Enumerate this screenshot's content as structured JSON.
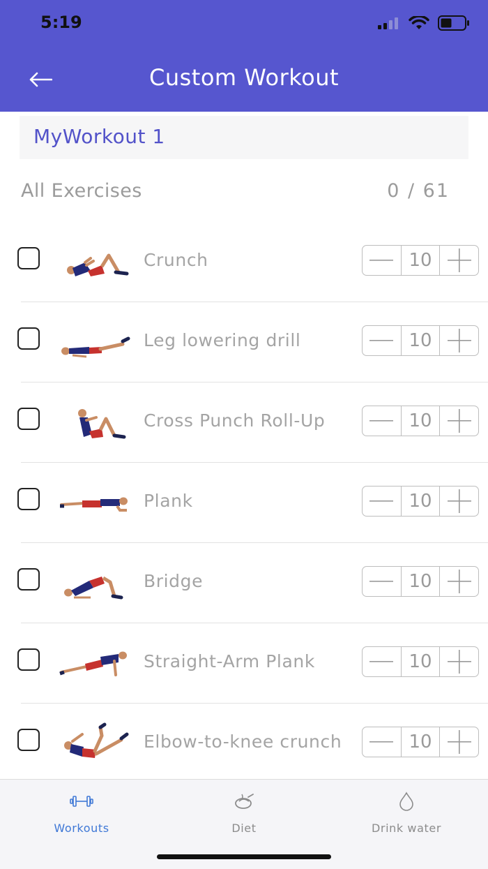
{
  "status_bar": {
    "time": "5:19"
  },
  "header": {
    "title": "Custom Workout",
    "back_icon": "back-arrow-icon"
  },
  "workout": {
    "name": "MyWorkout 1"
  },
  "list_header": {
    "label": "All Exercises",
    "count": "0 / 61"
  },
  "exercises": [
    {
      "name": "Crunch",
      "reps": "10",
      "checked": false
    },
    {
      "name": "Leg lowering drill",
      "reps": "10",
      "checked": false
    },
    {
      "name": "Cross Punch Roll-Up",
      "reps": "10",
      "checked": false
    },
    {
      "name": "Plank",
      "reps": "10",
      "checked": false
    },
    {
      "name": "Bridge",
      "reps": "10",
      "checked": false
    },
    {
      "name": "Straight-Arm Plank",
      "reps": "10",
      "checked": false
    },
    {
      "name": "Elbow-to-knee crunch",
      "reps": "10",
      "checked": false
    }
  ],
  "tabs": [
    {
      "label": "Workouts",
      "icon": "dumbbell-icon",
      "active": true
    },
    {
      "label": "Diet",
      "icon": "diet-plate-icon",
      "active": false
    },
    {
      "label": "Drink water",
      "icon": "water-drop-icon",
      "active": false
    }
  ],
  "colors": {
    "accent": "#5656cf",
    "tab_active": "#3f78d6",
    "muted_text": "#a4a4a4"
  }
}
